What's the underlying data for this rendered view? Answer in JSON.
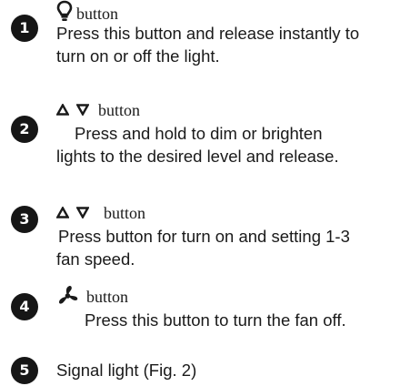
{
  "items": [
    {
      "number": "1",
      "icon": "light-bulb-icon",
      "button_label": "button",
      "description_lines": [
        "Press this button and release instantly to",
        "turn on or off the light."
      ]
    },
    {
      "number": "2",
      "icon": "up-down-triangle-icons",
      "button_label": "button",
      "description_lines": [
        "Press and hold to dim or brighten",
        "lights to the desired level and release."
      ]
    },
    {
      "number": "3",
      "icon": "up-down-triangle-icons",
      "button_label": "button",
      "description_lines": [
        "Press button for turn on and setting 1-3",
        "fan speed."
      ]
    },
    {
      "number": "4",
      "icon": "fan-icon",
      "button_label": "button",
      "description_lines": [
        "Press this button to turn the fan off."
      ]
    },
    {
      "number": "5",
      "description_lines": [
        "Signal light (Fig. 2)"
      ]
    }
  ],
  "colors": {
    "badge": "#161616",
    "text": "#1a1a1a"
  }
}
